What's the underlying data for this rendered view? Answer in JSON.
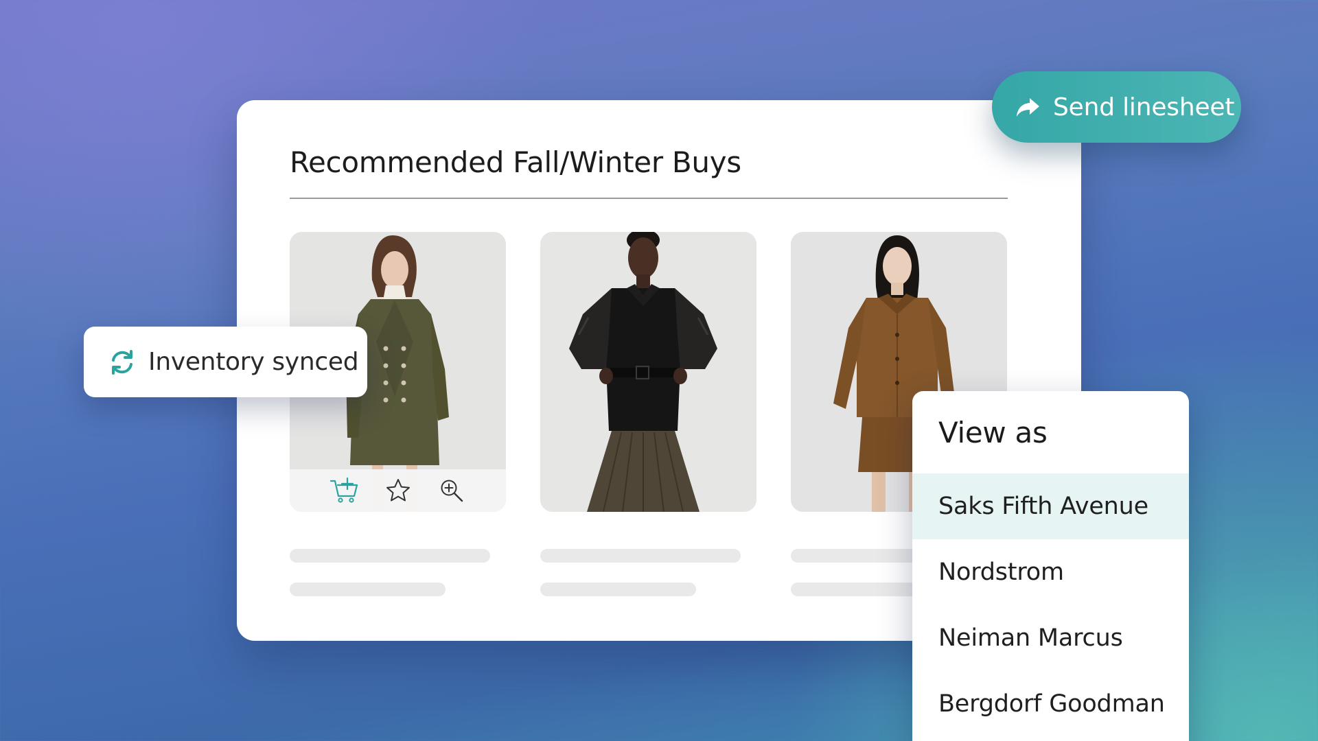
{
  "card": {
    "title": "Recommended Fall/Winter Buys"
  },
  "products": [
    {
      "image": "olive-trench-coat-model"
    },
    {
      "image": "black-leather-sleeve-jacket-model"
    },
    {
      "image": "brown-suede-jacket-model"
    }
  ],
  "product_actions": {
    "icons": [
      "add-to-cart-icon",
      "star-icon",
      "zoom-in-icon"
    ]
  },
  "inventory": {
    "label": "Inventory synced",
    "icon": "sync-icon",
    "icon_color": "#2aa39f"
  },
  "send_button": {
    "label": "Send linesheet",
    "icon": "share-arrow-icon",
    "color": "#3dadad"
  },
  "view_as": {
    "title": "View as",
    "options": [
      {
        "label": "Saks Fifth Avenue",
        "selected": true
      },
      {
        "label": "Nordstrom",
        "selected": false
      },
      {
        "label": "Neiman Marcus",
        "selected": false
      },
      {
        "label": "Bergdorf Goodman",
        "selected": false
      }
    ]
  },
  "colors": {
    "accent": "#2aa39f",
    "selected_row": "#e6f4f3",
    "skeleton": "#e9e9e9"
  }
}
